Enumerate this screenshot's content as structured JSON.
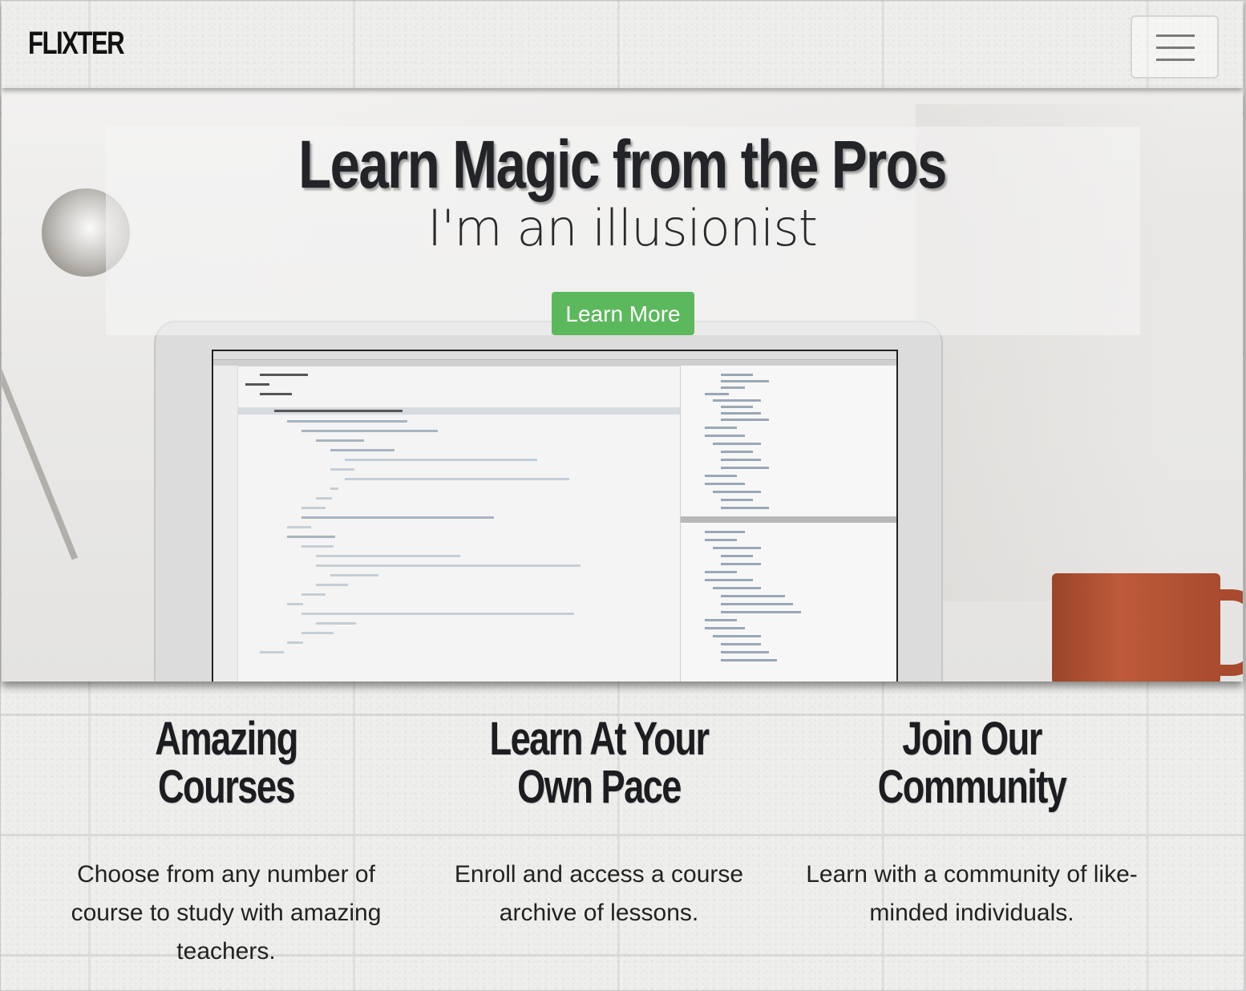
{
  "navbar": {
    "brand": "FLIXTER",
    "menu_toggle_icon": "hamburger-icon"
  },
  "hero": {
    "title": "Learn Magic from the Pros",
    "subtitle": "I'm an illusionist",
    "cta_label": "Learn More",
    "cta_color": "#5cb85c"
  },
  "features": [
    {
      "title": "Amazing Courses",
      "text": "Choose from any number of course to study with amazing teachers."
    },
    {
      "title": "Learn At Your Own Pace",
      "text": "Enroll and access a course archive of lessons."
    },
    {
      "title": "Join Our Community",
      "text": "Learn with a community of like-minded individuals."
    }
  ]
}
